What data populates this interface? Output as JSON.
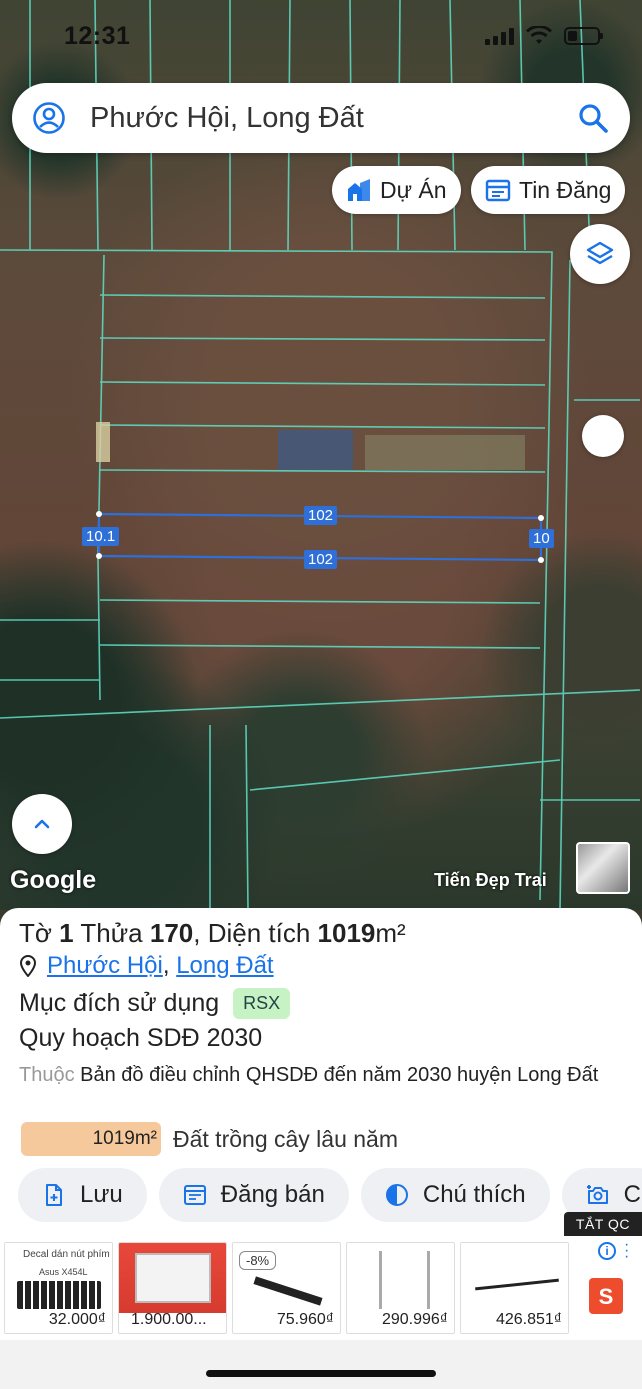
{
  "status": {
    "time": "12:31"
  },
  "search": {
    "query": "Phước Hội, Long Đất"
  },
  "chips": {
    "project": "Dự Án",
    "listing": "Tin Đăng"
  },
  "map": {
    "attribution": "Google",
    "contributor": "Tiến Đẹp Trai",
    "measurements": {
      "top_length": "102",
      "bottom_length": "102",
      "left_width": "10.1",
      "right_width": "10"
    },
    "parcel_line_color": "#5fe0c8",
    "measure_color": "#2f6fd8"
  },
  "parcel": {
    "sheet_label": "Tờ",
    "sheet_no": "1",
    "lot_label": "Thửa",
    "lot_no": "170",
    "area_label": ", Diện tích",
    "area_value": "1019",
    "area_unit": "m²",
    "ward": "Phước Hội",
    "district": "Long Đất",
    "purpose_label": "Mục đích sử dụng",
    "purpose_code": "RSX",
    "plan_label": "Quy hoạch SDĐ 2030",
    "belongs_prefix": "Thuộc",
    "belongs_text": "Bản đồ điều chỉnh QHSDĐ đến năm 2030 huyện Long Đất",
    "area_bar_label": "1019m²",
    "area_bar_desc": "Đất trồng cây lâu năm"
  },
  "actions": {
    "save": "Lưu",
    "sell": "Đăng bán",
    "legend": "Chú thích",
    "capture": "C"
  },
  "ad": {
    "label": "TẮT QC",
    "items": [
      {
        "price": "32.000₫",
        "title": "Decal dán nút phím",
        "sub": "Asus X454L"
      },
      {
        "price": "1.900.00..."
      },
      {
        "price": "75.960₫",
        "discount": "-8%"
      },
      {
        "price": "290.996₫"
      },
      {
        "price": "426.851₫"
      }
    ]
  }
}
